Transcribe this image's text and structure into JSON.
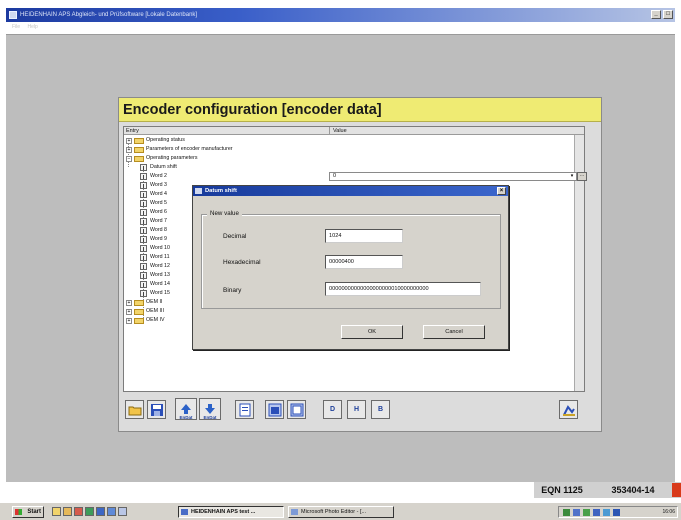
{
  "window": {
    "title": "HEIDENHAIN APS Abgleich- und Prüfsoftware [Lokale Datenbank]",
    "menu": [
      "File",
      "Help"
    ],
    "controls": [
      "_",
      "□"
    ]
  },
  "config": {
    "title": "Encoder configuration [encoder data]",
    "columns": {
      "entry": "Entry",
      "value": "Value"
    },
    "tree": {
      "operating_status": "Operating status",
      "parameters_manufacturer": "Parameters of encoder manufacturer",
      "operating_parameters": "Operating parameters",
      "datum_shift": "Datum shift",
      "words": [
        "Word 2",
        "Word 3",
        "Word 4",
        "Word 5",
        "Word 6",
        "Word 7",
        "Word 8",
        "Word 9",
        "Word 10",
        "Word 11",
        "Word 12",
        "Word 13",
        "Word 14",
        "Word 15"
      ],
      "oem_ii": "OEM II",
      "oem_iii": "OEM III",
      "oem_iv": "OEM IV"
    },
    "datum_shift_value": "0",
    "toolbar": {
      "endat_label_1": "EnDat",
      "endat_label_2": "EnDat",
      "d": "D",
      "h": "H",
      "b": "B"
    }
  },
  "dialog": {
    "title": "Datum shift",
    "close": "×",
    "group_label": "New value",
    "decimal_label": "Decimal",
    "decimal_value": "1024",
    "hex_label": "Hexadecimal",
    "hex_value": "00000400",
    "binary_label": "Binary",
    "binary_value": "00000000000000000000010000000000",
    "ok": "OK",
    "cancel": "Cancel"
  },
  "status": {
    "model": "EQN 1125",
    "serial": "353404-14"
  },
  "taskbar": {
    "start": "Start",
    "tasks": [
      "HEIDENHAIN APS test ...",
      "Microsoft Photo Editor - [..."
    ],
    "clock": "16:06"
  }
}
